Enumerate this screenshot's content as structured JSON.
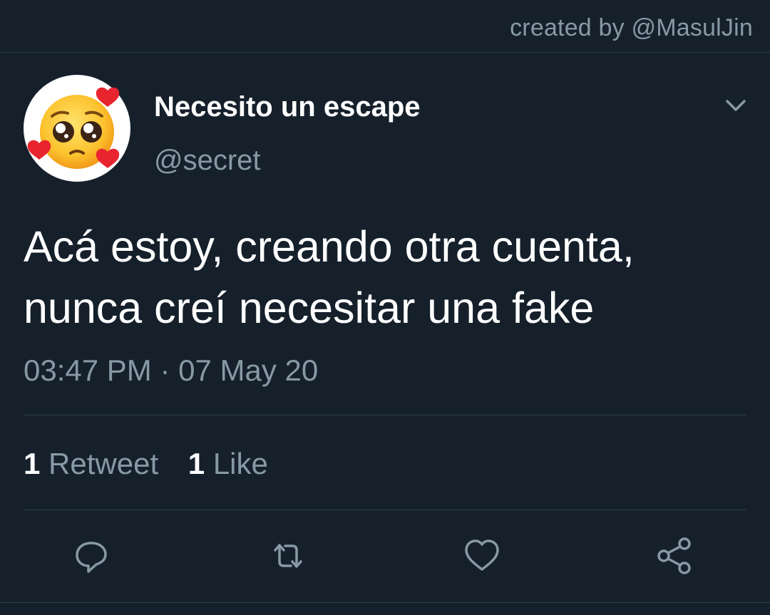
{
  "credit": "created by @MasulJin",
  "tweet": {
    "display_name": "Necesito un escape",
    "handle": "@secret",
    "text_line1": "Acá estoy, creando otra cuenta,",
    "text_line2": "nunca creí necesitar una fake",
    "timestamp": "03:47 PM · 07 May 20"
  },
  "stats": {
    "retweets_count": "1",
    "retweets_label": "Retweet",
    "likes_count": "1",
    "likes_label": "Like"
  },
  "avatar_icon": "pleading-face-with-hearts-emoji",
  "actions": [
    {
      "icon": "reply-icon"
    },
    {
      "icon": "retweet-icon"
    },
    {
      "icon": "like-icon"
    },
    {
      "icon": "share-icon"
    }
  ],
  "colors": {
    "background": "#15202b",
    "secondary_text": "#8899a6",
    "divider": "#2f3d4a"
  }
}
